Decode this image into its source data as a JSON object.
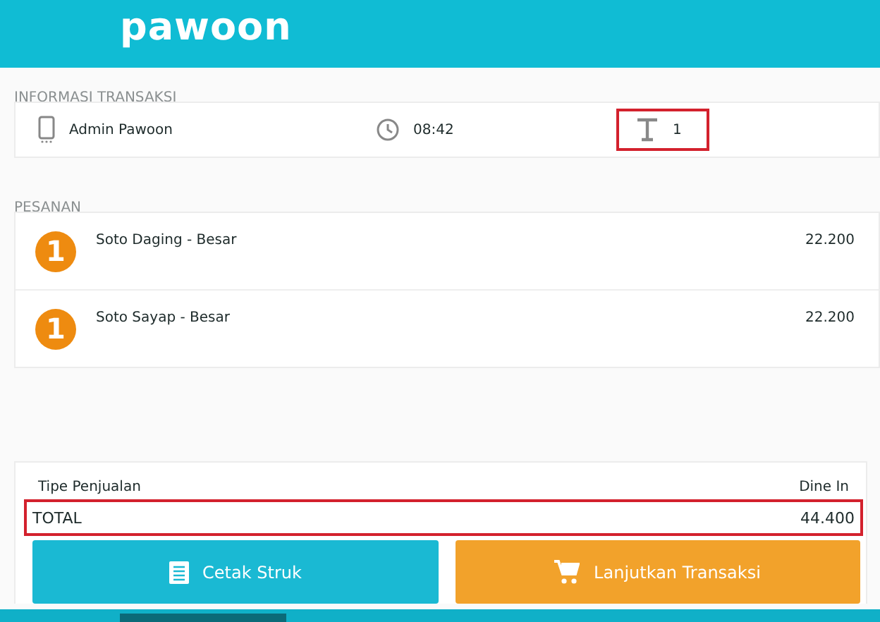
{
  "header": {
    "logo": "pawoon"
  },
  "transaction_info": {
    "heading": "INFORMASI TRANSAKSI",
    "cashier": "Admin Pawoon",
    "time": "08:42",
    "table": "1",
    "table_highlighted": true
  },
  "orders": {
    "heading": "PESANAN",
    "items": [
      {
        "quantity": "1",
        "name": "Soto Daging - Besar",
        "price": "22.200"
      },
      {
        "quantity": "1",
        "name": "Soto Sayap - Besar",
        "price": "22.200"
      }
    ]
  },
  "summary": {
    "sales_type_label": "Tipe Penjualan",
    "sales_type": "Dine In",
    "total_label": "TOTAL",
    "total": "44.400",
    "total_highlighted": true
  },
  "buttons": [
    {
      "kind": "print",
      "label": "Cetak Struk"
    },
    {
      "kind": "cart",
      "label": "Lanjutkan Transaksi"
    }
  ]
}
